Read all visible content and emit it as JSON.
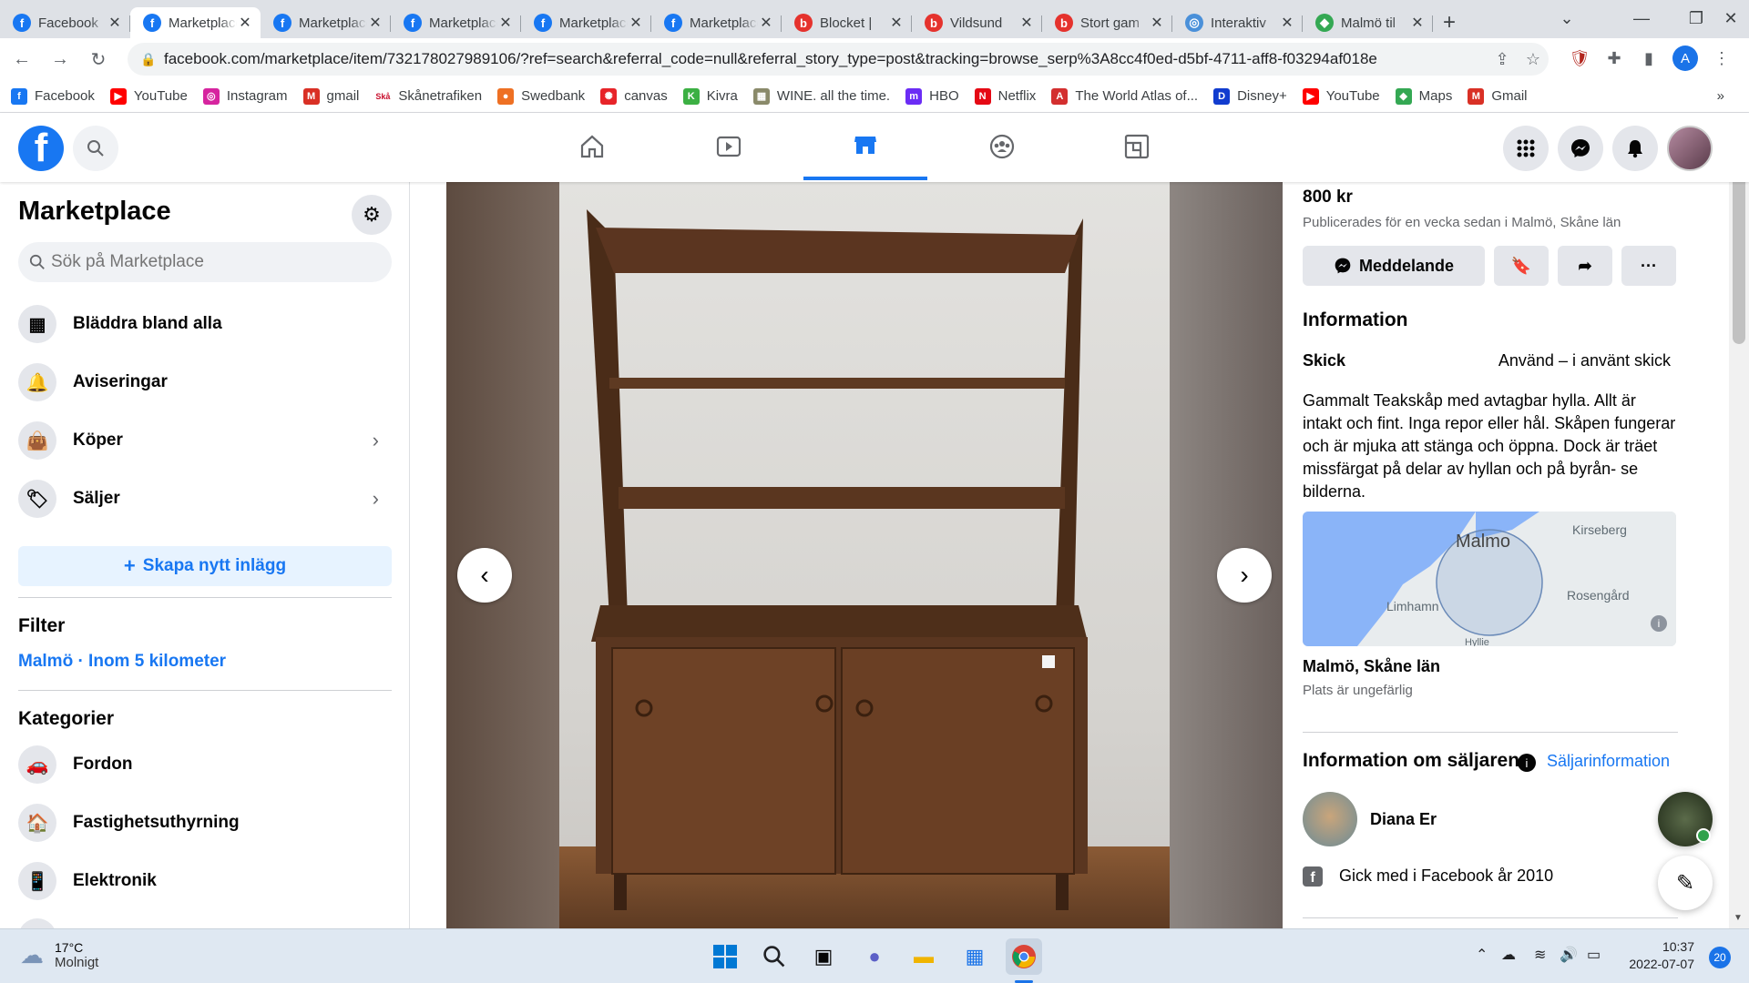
{
  "browser": {
    "tabs": [
      {
        "title": "Facebook",
        "icon": "facebook-icon",
        "color": "#1877f2",
        "active": false
      },
      {
        "title": "Marketplace",
        "icon": "facebook-icon",
        "color": "#1877f2",
        "active": true
      },
      {
        "title": "Marketplace",
        "icon": "facebook-icon",
        "color": "#1877f2",
        "active": false
      },
      {
        "title": "Marketplace",
        "icon": "facebook-icon",
        "color": "#1877f2",
        "active": false
      },
      {
        "title": "Marketplace",
        "icon": "facebook-icon",
        "color": "#1877f2",
        "active": false
      },
      {
        "title": "Marketplace",
        "icon": "facebook-icon",
        "color": "#1877f2",
        "active": false
      },
      {
        "title": "Blocket |",
        "icon": "blocket-icon",
        "color": "#e5322d",
        "active": false
      },
      {
        "title": "Vildsund",
        "icon": "blocket-icon",
        "color": "#e5322d",
        "active": false
      },
      {
        "title": "Stort gam",
        "icon": "blocket-icon",
        "color": "#e5322d",
        "active": false
      },
      {
        "title": "Interaktiv",
        "icon": "globe-icon",
        "color": "#4a90d9",
        "active": false
      },
      {
        "title": "Malmö til",
        "icon": "maps-icon",
        "color": "#34a853",
        "active": false
      }
    ],
    "new_tab_label": "+",
    "url": "facebook.com/marketplace/item/732178027989106/?ref=search&referral_code=null&referral_story_type=post&tracking=browse_serp%3A8cc4f0ed-d5bf-4711-aff8-f03294af018e",
    "profile_initial": "A",
    "bookmarks": [
      {
        "label": "Facebook",
        "icon": "facebook-icon",
        "color": "#1877f2",
        "glyph": "f"
      },
      {
        "label": "YouTube",
        "icon": "youtube-icon",
        "color": "#ff0000",
        "glyph": "▶"
      },
      {
        "label": "Instagram",
        "icon": "instagram-icon",
        "color": "#d6249f",
        "glyph": "◎"
      },
      {
        "label": "gmail",
        "icon": "gmail-icon",
        "color": "#d93025",
        "glyph": "M"
      },
      {
        "label": "Skånetrafiken",
        "icon": "skanetrafiken-icon",
        "color": "#ffffff",
        "glyph": "Skå"
      },
      {
        "label": "Swedbank",
        "icon": "swedbank-icon",
        "color": "#ee7023",
        "glyph": "●"
      },
      {
        "label": "canvas",
        "icon": "canvas-icon",
        "color": "#e72429",
        "glyph": "✺"
      },
      {
        "label": "Kivra",
        "icon": "kivra-icon",
        "color": "#3cb043",
        "glyph": "K"
      },
      {
        "label": "WINE. all the time.",
        "icon": "wine-icon",
        "color": "#8a8a6a",
        "glyph": "▦"
      },
      {
        "label": "HBO",
        "icon": "hbo-icon",
        "color": "#6b2cf5",
        "glyph": "m"
      },
      {
        "label": "Netflix",
        "icon": "netflix-icon",
        "color": "#e50914",
        "glyph": "N"
      },
      {
        "label": "The World Atlas of...",
        "icon": "atlas-icon",
        "color": "#d32f2f",
        "glyph": "A"
      },
      {
        "label": "Disney+",
        "icon": "disney-icon",
        "color": "#113ccf",
        "glyph": "D"
      },
      {
        "label": "YouTube",
        "icon": "youtube-icon",
        "color": "#ff0000",
        "glyph": "▶"
      },
      {
        "label": "Maps",
        "icon": "maps-icon",
        "color": "#34a853",
        "glyph": "◆"
      },
      {
        "label": "Gmail",
        "icon": "gmail-icon",
        "color": "#d93025",
        "glyph": "M"
      }
    ],
    "bookmarks_more": "»"
  },
  "sidebar": {
    "title": "Marketplace",
    "search_placeholder": "Sök på Marketplace",
    "nav_items": [
      {
        "label": "Bläddra bland alla",
        "icon": "shop-icon",
        "glyph": "▦",
        "chevron": false
      },
      {
        "label": "Aviseringar",
        "icon": "bell-icon",
        "glyph": "🔔",
        "chevron": false
      },
      {
        "label": "Köper",
        "icon": "shopping-bag-icon",
        "glyph": "👜",
        "chevron": true
      },
      {
        "label": "Säljer",
        "icon": "tag-icon",
        "glyph": "🏷",
        "chevron": true
      }
    ],
    "create_label": "Skapa nytt inlägg",
    "filter_heading": "Filter",
    "filter_value": "Malmö · Inom 5 kilometer",
    "categories_heading": "Kategorier",
    "categories": [
      {
        "label": "Fordon",
        "icon": "car-icon",
        "glyph": "🚗"
      },
      {
        "label": "Fastighetsuthyrning",
        "icon": "house-icon",
        "glyph": "🏠"
      },
      {
        "label": "Elektronik",
        "icon": "phone-icon",
        "glyph": "📱"
      }
    ]
  },
  "listing": {
    "price": "800 kr",
    "published": "Publicerades för en vecka sedan i Malmö, Skåne län",
    "message_label": "Meddelande",
    "info_heading": "Information",
    "condition_label": "Skick",
    "condition_value": "Använd – i använt skick",
    "description": "Gammalt Teakskåp med avtagbar hylla. Allt är intakt och fint. Inga repor eller hål. Skåpen fungerar och är mjuka att stänga och öppna. Dock är träet missfärgat på delar av hyllan och på byrån- se bilderna.",
    "map_labels": {
      "city": "Malmo",
      "kirseberg": "Kirseberg",
      "rosengard": "Rosengård",
      "limhamn": "Limhamn",
      "hyllie": "Hyllie"
    },
    "location": "Malmö, Skåne län",
    "location_note": "Plats är ungefärlig",
    "seller_heading": "Information om säljaren",
    "seller_link": "Säljarinformation",
    "seller_name": "Diana Er",
    "joined": "Gick med i Facebook år 2010"
  },
  "taskbar": {
    "temperature": "17°C",
    "weather": "Molnigt",
    "time": "10:37",
    "date": "2022-07-07",
    "notifications": "20"
  }
}
